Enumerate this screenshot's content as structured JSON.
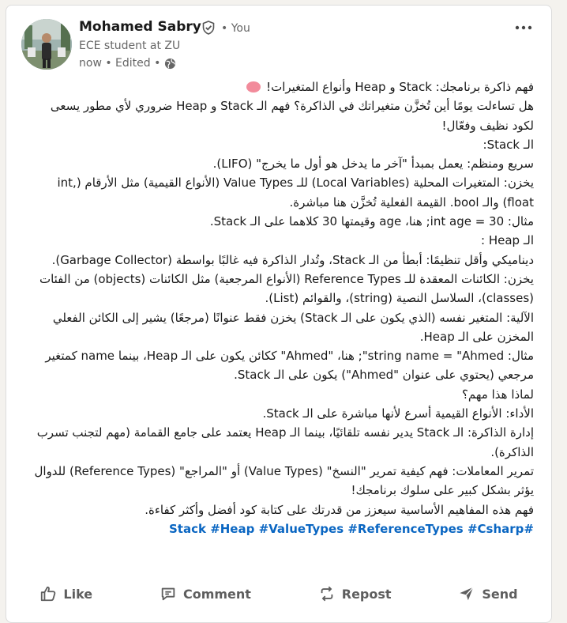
{
  "author": {
    "name": "Mohamed Sabry",
    "you_label": "• You",
    "headline": "ECE student at ZU",
    "meta": "now • Edited •"
  },
  "colors": {
    "link": "#0a66c2",
    "text": "#191919",
    "muted": "#666666"
  },
  "post": {
    "lines": [
      "فهم ذاكرة برنامجك: Stack و Heap وأنواع المتغيرات!",
      "هل تساءلت يومًا أين تُخزَّن متغيراتك في الذاكرة؟ فهم الـ Stack و Heap ضروري لأي مطور يسعى لكود نظيف وفعّال!",
      "الـ Stack:",
      "سريع ومنظم: يعمل بمبدأ \"آخر ما يدخل هو أول ما يخرج\" (LIFO).",
      "يخزن: المتغيرات المحلية (Local Variables) للـ Value Types (الأنواع القيمية) مثل الأرقام (int, float) والـ bool. القيمة الفعلية تُخزَّن هنا مباشرة.",
      "مثال: int age = 30; هنا، age وقيمتها 30 كلاهما على الـ Stack.",
      "الـ Heap :",
      "ديناميكي وأقل تنظيمًا: أبطأ من الـ Stack، وتُدار الذاكرة فيه غالبًا بواسطة (Garbage Collector).",
      "يخزن: الكائنات المعقدة للـ Reference Types (الأنواع المرجعية) مثل الكائنات (objects) من الفئات (classes)، السلاسل النصية (string)، والقوائم (List).",
      "الآلية: المتغير نفسه (الذي يكون على الـ Stack) يخزن فقط عنوانًا (مرجعًا) يشير إلى الكائن الفعلي المخزن على الـ Heap.",
      "مثال: string name = \"Ahmed\"; هنا، \"Ahmed\" ككائن يكون على الـ Heap، بينما name كمتغير مرجعي (يحتوي على عنوان \"Ahmed\") يكون على الـ Stack.",
      "لماذا هذا مهم؟",
      "الأداء: الأنواع القيمية أسرع لأنها مباشرة على الـ Stack.",
      "إدارة الذاكرة: الـ Stack يدير نفسه تلقائيًا، بينما الـ Heap يعتمد على جامع القمامة (مهم لتجنب تسرب الذاكرة).",
      "تمرير المعاملات: فهم كيفية تمرير \"النسخ\" (Value Types) أو \"المراجع\" (Reference Types) للدوال يؤثر بشكل كبير على سلوك برنامجك!",
      "فهم هذه المفاهيم الأساسية سيعزز من قدرتك على كتابة كود أفضل وأكثر كفاءة."
    ],
    "hashtags": [
      "#Stack",
      "#Heap",
      "#ValueTypes",
      "#ReferenceTypes",
      "#Csharp"
    ]
  },
  "actions": {
    "like": "Like",
    "comment": "Comment",
    "repost": "Repost",
    "send": "Send"
  }
}
